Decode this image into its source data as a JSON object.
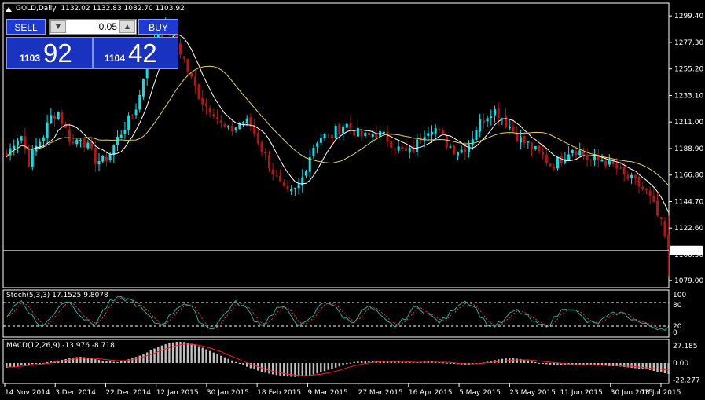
{
  "header": {
    "symbol": "GOLD,Daily",
    "ohlc": "1132.02 1132.83 1082.70 1103.92"
  },
  "trade_panel": {
    "sell_label": "SELL",
    "buy_label": "BUY",
    "lot": "0.05",
    "bid_small": "1103",
    "bid_big": "92",
    "ask_small": "1104",
    "ask_big": "42"
  },
  "current_price_label": "1103.92",
  "stoch_label": "Stoch(5,3,3) 17.1525 9.8078",
  "macd_label": "MACD(12,26,9) -13.976 -8.718",
  "colors": {
    "background": "#000000",
    "bull_candle": "#00e5ee",
    "bear_candle": "#c01010",
    "ma_fast": "#ffffff",
    "ma_slow": "#e8d060",
    "stoch_main": "#20b2aa",
    "stoch_signal": "#ff3030",
    "macd_hist": "#c0c0c0",
    "macd_signal": "#ff2020",
    "grid": "#ffffff"
  },
  "chart_data": [
    {
      "type": "candlestick",
      "title": "GOLD,Daily",
      "y_ticks": [
        "1299.40",
        "1277.30",
        "1255.20",
        "1233.10",
        "1211.00",
        "1188.90",
        "1166.80",
        "1144.70",
        "1122.60",
        "1100.50",
        "1079.00"
      ],
      "ylim": [
        1073,
        1310
      ],
      "x_ticks": [
        "14 Nov 2014",
        "3 Dec 2014",
        "22 Dec 2014",
        "12 Jan 2015",
        "30 Jan 2015",
        "18 Feb 2015",
        "9 Mar 2015",
        "27 Mar 2015",
        "16 Apr 2015",
        "5 May 2015",
        "23 May 2015",
        "11 Jun 2015",
        "30 Jun 2015",
        "18 Jul 2015"
      ],
      "close_anchors": [
        1182,
        1195,
        1200,
        1178,
        1190,
        1200,
        1215,
        1220,
        1205,
        1192,
        1200,
        1190,
        1180,
        1178,
        1184,
        1196,
        1207,
        1215,
        1230,
        1260,
        1282,
        1294,
        1287,
        1278,
        1265,
        1248,
        1235,
        1225,
        1222,
        1210,
        1203,
        1206,
        1212,
        1210,
        1198,
        1185,
        1172,
        1160,
        1150,
        1152,
        1160,
        1180,
        1195,
        1200,
        1198,
        1205,
        1210,
        1205,
        1200,
        1198,
        1202,
        1200,
        1196,
        1190,
        1185,
        1186,
        1195,
        1205,
        1208,
        1200,
        1192,
        1188,
        1188,
        1195,
        1208,
        1215,
        1222,
        1218,
        1210,
        1203,
        1195,
        1192,
        1186,
        1182,
        1175,
        1178,
        1185,
        1190,
        1186,
        1180,
        1178,
        1180,
        1176,
        1172,
        1165,
        1162,
        1158,
        1152,
        1140,
        1125,
        1104
      ],
      "current_price": 1103.92
    },
    {
      "type": "line",
      "title": "Stoch(5,3,3) 17.1525 9.8078",
      "y_ticks": [
        "100",
        "80",
        "20",
        "0"
      ],
      "levels": [
        20,
        80
      ],
      "ylim": [
        0,
        100
      ],
      "series": [
        {
          "name": "main",
          "values": [
            45,
            70,
            85,
            60,
            30,
            20,
            40,
            70,
            85,
            75,
            50,
            30,
            25,
            55,
            80,
            88,
            90,
            85,
            70,
            50,
            30,
            25,
            40,
            65,
            80,
            70,
            40,
            20,
            15,
            35,
            60,
            80,
            75,
            55,
            30,
            25,
            50,
            70,
            60,
            40,
            20,
            30,
            55,
            85,
            80,
            60,
            40,
            30,
            50,
            70,
            60,
            40,
            25,
            20,
            35,
            60,
            70,
            55,
            40,
            30,
            45,
            70,
            85,
            80,
            60,
            30,
            20,
            25,
            40,
            60,
            55,
            40,
            25,
            20,
            30,
            50,
            70,
            65,
            45,
            30,
            25,
            35,
            45,
            55,
            50,
            40,
            30,
            22,
            18,
            15,
            17
          ]
        }
      ]
    },
    {
      "type": "bar",
      "title": "MACD(12,26,9) -13.976 -8.718",
      "y_ticks": [
        "27.185",
        "0.00",
        "-22.277"
      ],
      "ylim": [
        -26,
        30
      ],
      "series": [
        {
          "name": "hist",
          "values": [
            -6,
            -5,
            -3,
            -2,
            -1,
            0,
            2,
            3,
            5,
            7,
            8,
            7,
            5,
            3,
            2,
            1,
            3,
            6,
            9,
            13,
            18,
            22,
            25,
            27,
            27,
            25,
            22,
            18,
            14,
            10,
            6,
            2,
            -2,
            -6,
            -9,
            -12,
            -14,
            -16,
            -17,
            -18,
            -17,
            -16,
            -14,
            -11,
            -8,
            -5,
            -2,
            1,
            2,
            3,
            3,
            3,
            2,
            2,
            1,
            1,
            1,
            2,
            2,
            1,
            0,
            -1,
            -2,
            -2,
            -1,
            1,
            3,
            5,
            6,
            6,
            5,
            3,
            1,
            -1,
            -2,
            -3,
            -3,
            -3,
            -2,
            -2,
            -3,
            -3,
            -4,
            -4,
            -5,
            -6,
            -7,
            -8,
            -10,
            -12,
            -14
          ]
        },
        {
          "name": "signal",
          "values": [
            -5,
            -5,
            -4,
            -3,
            -2,
            -1,
            0,
            2,
            3,
            5,
            6,
            6,
            6,
            5,
            4,
            3,
            3,
            4,
            6,
            9,
            12,
            16,
            19,
            22,
            24,
            24,
            23,
            21,
            18,
            15,
            11,
            7,
            3,
            -1,
            -4,
            -7,
            -10,
            -12,
            -14,
            -15,
            -16,
            -16,
            -15,
            -14,
            -12,
            -10,
            -7,
            -4,
            -2,
            0,
            1,
            2,
            2,
            2,
            2,
            1,
            1,
            1,
            1,
            1,
            1,
            0,
            -1,
            -1,
            -1,
            0,
            1,
            2,
            3,
            4,
            4,
            4,
            3,
            2,
            1,
            0,
            -1,
            -2,
            -2,
            -2,
            -2,
            -3,
            -3,
            -3,
            -4,
            -4,
            -5,
            -6,
            -7,
            -8,
            -9
          ]
        }
      ]
    }
  ]
}
